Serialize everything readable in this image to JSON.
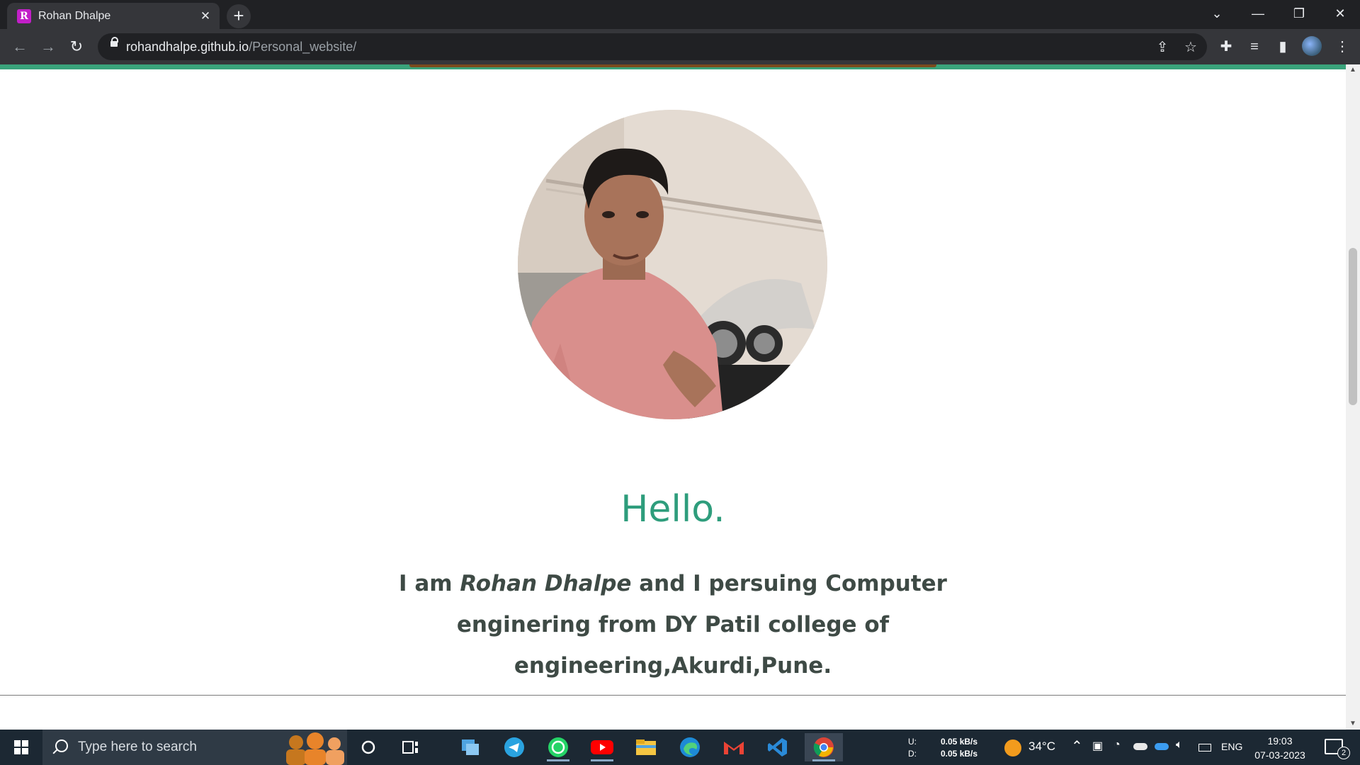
{
  "browser": {
    "tab_title": "Rohan Dhalpe",
    "tab_favicon_letter": "R",
    "url_host": "rohandhalpe.github.io",
    "url_path": "/Personal_website/"
  },
  "page": {
    "greeting": "Hello.",
    "intro_prefix": "I am ",
    "intro_name": "Rohan Dhalpe",
    "intro_suffix": " and I persuing Computer enginering from DY Patil college of engineering,Akurdi,Pune.",
    "accent_color": "#2e9d7c"
  },
  "taskbar": {
    "search_placeholder": "Type here to search",
    "net_up_label": "U:",
    "net_down_label": "D:",
    "net_up_value": "0.05 kB/s",
    "net_down_value": "0.05 kB/s",
    "temperature": "34°C",
    "language": "ENG",
    "time": "19:03",
    "date": "07-03-2023",
    "notification_count": "2"
  }
}
